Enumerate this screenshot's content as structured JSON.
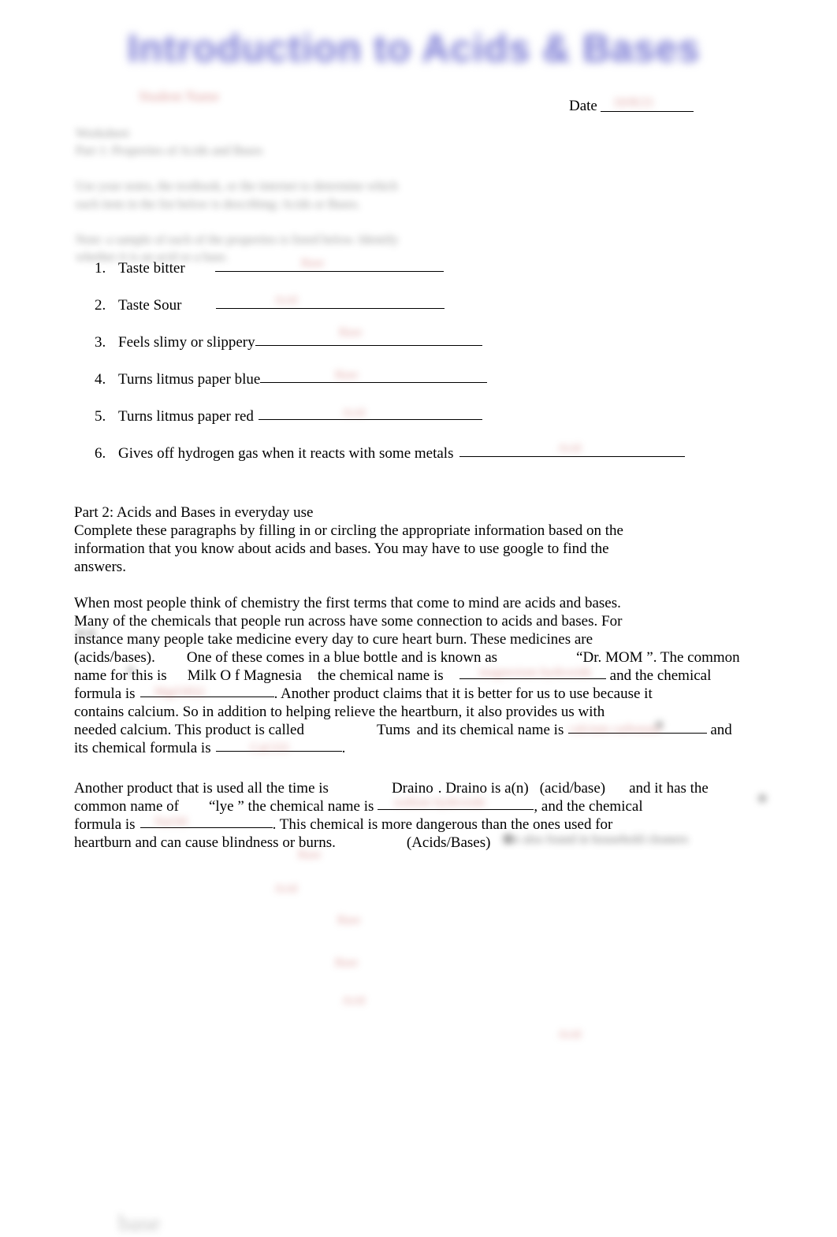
{
  "document": {
    "title": "Introduction to Acids & Bases",
    "title_color": "#7B7BD4",
    "date_label": "Date",
    "name_ghost": "Student Name",
    "date_ghost": "10/8/21"
  },
  "part1": {
    "heading_ghost_line1": "Worksheet",
    "heading_ghost_line2": "Part 1: Properties of Acids and Bases",
    "instructions_ghost_line1": "Use your notes, the textbook, or the internet to determine which",
    "instructions_ghost_line2": "each item in the list below is describing: Acids or Bases.",
    "instructions_ghost_line3": "Note: a sample of each of the properties is listed below. Identify",
    "instructions_ghost_line4": "whether it is an acid or a base.",
    "items": [
      {
        "number": "1.",
        "text": "Taste bitter",
        "answer_ghost": "Base"
      },
      {
        "number": "2.",
        "text": "Taste Sour",
        "answer_ghost": "Acid"
      },
      {
        "number": "3.",
        "text": "Feels slimy or slippery",
        "answer_ghost": "Base"
      },
      {
        "number": "4.",
        "text": "Turns litmus paper blue",
        "answer_ghost": "Base"
      },
      {
        "number": "5.",
        "text": "Turns litmus paper red",
        "answer_ghost": "Acid"
      },
      {
        "number": "6.",
        "text": "Gives off hydrogen gas when it reacts with some metals",
        "answer_ghost": "Acid"
      }
    ]
  },
  "part2": {
    "heading": "Part 2: Acids and Bases in everyday use",
    "intro_line1": "Complete these paragraphs by filling in or circling the appropriate information based on the",
    "intro_line2": "information that you know about acids and bases. You may have to use google to find the",
    "intro_line3": "answers.",
    "paragraph1": {
      "l1": "When most people think of chemistry the first terms that come to mind are acids and bases.",
      "l2": "Many of the chemicals that people run across have some connection to acids and bases. For",
      "l3": "instance many people take medicine every day to cure heart burn. These medicines are",
      "l4_a": "(acids/bases).",
      "l4_b": "One of these comes in a blue bottle and is known as",
      "l4_c": "“Dr. MOM ”. The common",
      "l5_a": "name for this is",
      "l5_b": "Milk O f Magnesia",
      "l5_c": "the chemical name is",
      "l5_d": "and the chemical",
      "l6_a": "formula is",
      "l6_b": ". Another product claims that it is better for us to use because it",
      "l7": "contains calcium. So in addition to helping relieve the heartburn, it also provides us with",
      "l8_a": "needed calcium. This product is called",
      "l8_b": "Tums",
      "l8_c": "and its chemical name is",
      "l8_d": "and",
      "l9_a": "its chemical formula is",
      "l9_b": ".",
      "ghost_answer_1": "magnesium hydroxide",
      "ghost_answer_2": "Mg(OH)2",
      "ghost_answer_3": "calcium carbonate",
      "ghost_answer_4": "CaCO3"
    },
    "paragraph2": {
      "l1_a": "Another product that is used all the time is",
      "l1_b": "Draino",
      "l1_c": ". Draino is a(n)",
      "l1_d": "(acid/base)",
      "l1_e": "and it has the",
      "l2_a": "common name of",
      "l2_b": "“lye ” the chemical name is",
      "l2_c": ", and the chemical",
      "l3_a": "formula is",
      "l3_b": ". This chemical is more dangerous than the ones used for",
      "l4_a": "heartburn and can cause blindness or burns.",
      "l4_b": "(Acids/Bases)",
      "l4_ghost": "are also found in household cleaners",
      "ghost_answer_1": "sodium hydroxide",
      "ghost_answer_2": "NaOH"
    }
  },
  "stray_ghosts": {
    "g1": "Base",
    "g2": "Acid",
    "g3": "Base",
    "g4": "Base",
    "g5": "Acid",
    "g6": "Acid",
    "g7": "base"
  }
}
